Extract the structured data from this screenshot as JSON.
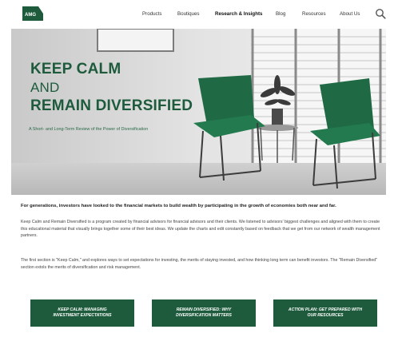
{
  "header": {
    "logo_text": "AMG",
    "nav": [
      {
        "label": "Products"
      },
      {
        "label": "Boutiques"
      },
      {
        "label": "Research & Insights"
      },
      {
        "label": "Blog"
      },
      {
        "label": "Resources"
      },
      {
        "label": "About Us"
      }
    ],
    "active_nav": "Research & Insights",
    "search_icon": "search-icon"
  },
  "hero": {
    "title_line1": "KEEP CALM",
    "title_line2": "AND",
    "title_line3": "REMAIN DIVERSIFIED",
    "subtitle": "A Short- and Long-Term Review of the Power of Diversification",
    "title_color": "#1d5b3c",
    "chair_color": "#1f6a45"
  },
  "content": {
    "intro": "For generations, investors have looked to the financial markets to build wealth by participating in the growth of economies both near and far.",
    "paragraph1": "Keep Calm and Remain Diversified is a program created by financial advisors for financial advisors and their clients. We listened to advisors' biggest challenges and aligned with them to create this educational material that visually brings together some of their best ideas. We update the charts and edit constantly based on feedback that we get from our network of wealth management partners.",
    "paragraph2": "The first section is \"Keep Calm,\" and explores ways to set expectations for investing, the merits of staying invested, and how thinking long term can benefit investors. The \"Remain Diversified\" section extols the merits of diversification and risk management."
  },
  "ctas": [
    {
      "label": "KEEP CALM: MANAGING INVESTMENT EXPECTATIONS"
    },
    {
      "label": "REMAIN DIVERSIFIED: WHY DIVERSIFICATION MATTERS"
    },
    {
      "label": "ACTION PLAN: GET PREPARED WITH OUR RESOURCES"
    }
  ],
  "colors": {
    "brand_green": "#1d5b3c",
    "background": "#ffffff"
  }
}
